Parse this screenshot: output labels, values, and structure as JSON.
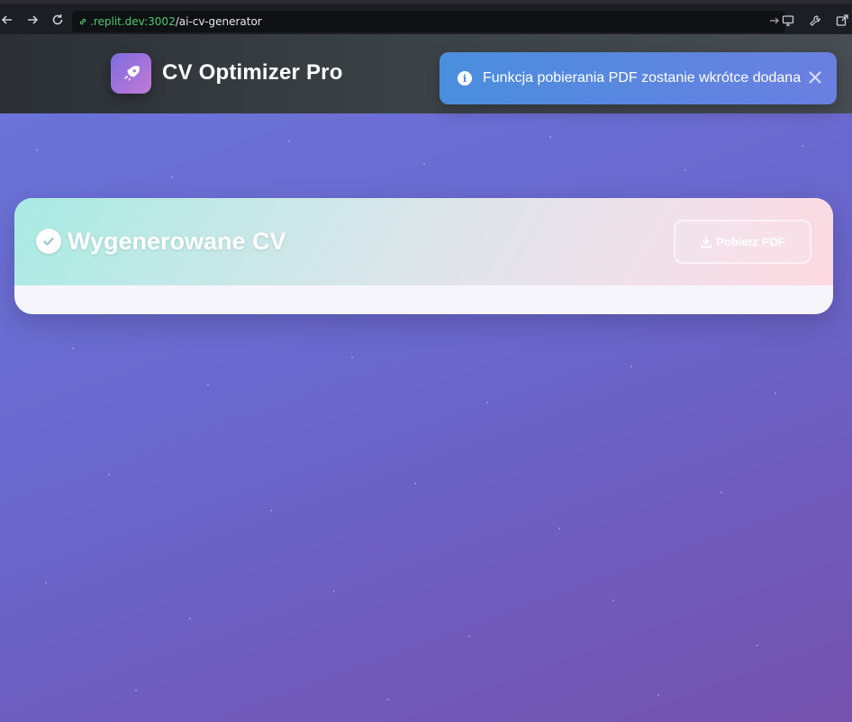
{
  "browser": {
    "url_host": ".replit.dev:3002",
    "url_path": "/ai-cv-generator"
  },
  "header": {
    "title": "CV Optimizer Pro",
    "logo_icon": "rocket-icon"
  },
  "toast": {
    "icon": "info-icon",
    "icon_glyph": "i",
    "message": "Funkcja pobierania PDF zostanie wkrótce dodana"
  },
  "card": {
    "title": "Wygenerowane CV",
    "download_label": "Pobierz PDF"
  },
  "colors": {
    "accent": "#6a6fd6",
    "toast_start": "#4a8ede",
    "card_header_start": "#a9ebe3",
    "card_header_end": "#fcd9e2"
  }
}
